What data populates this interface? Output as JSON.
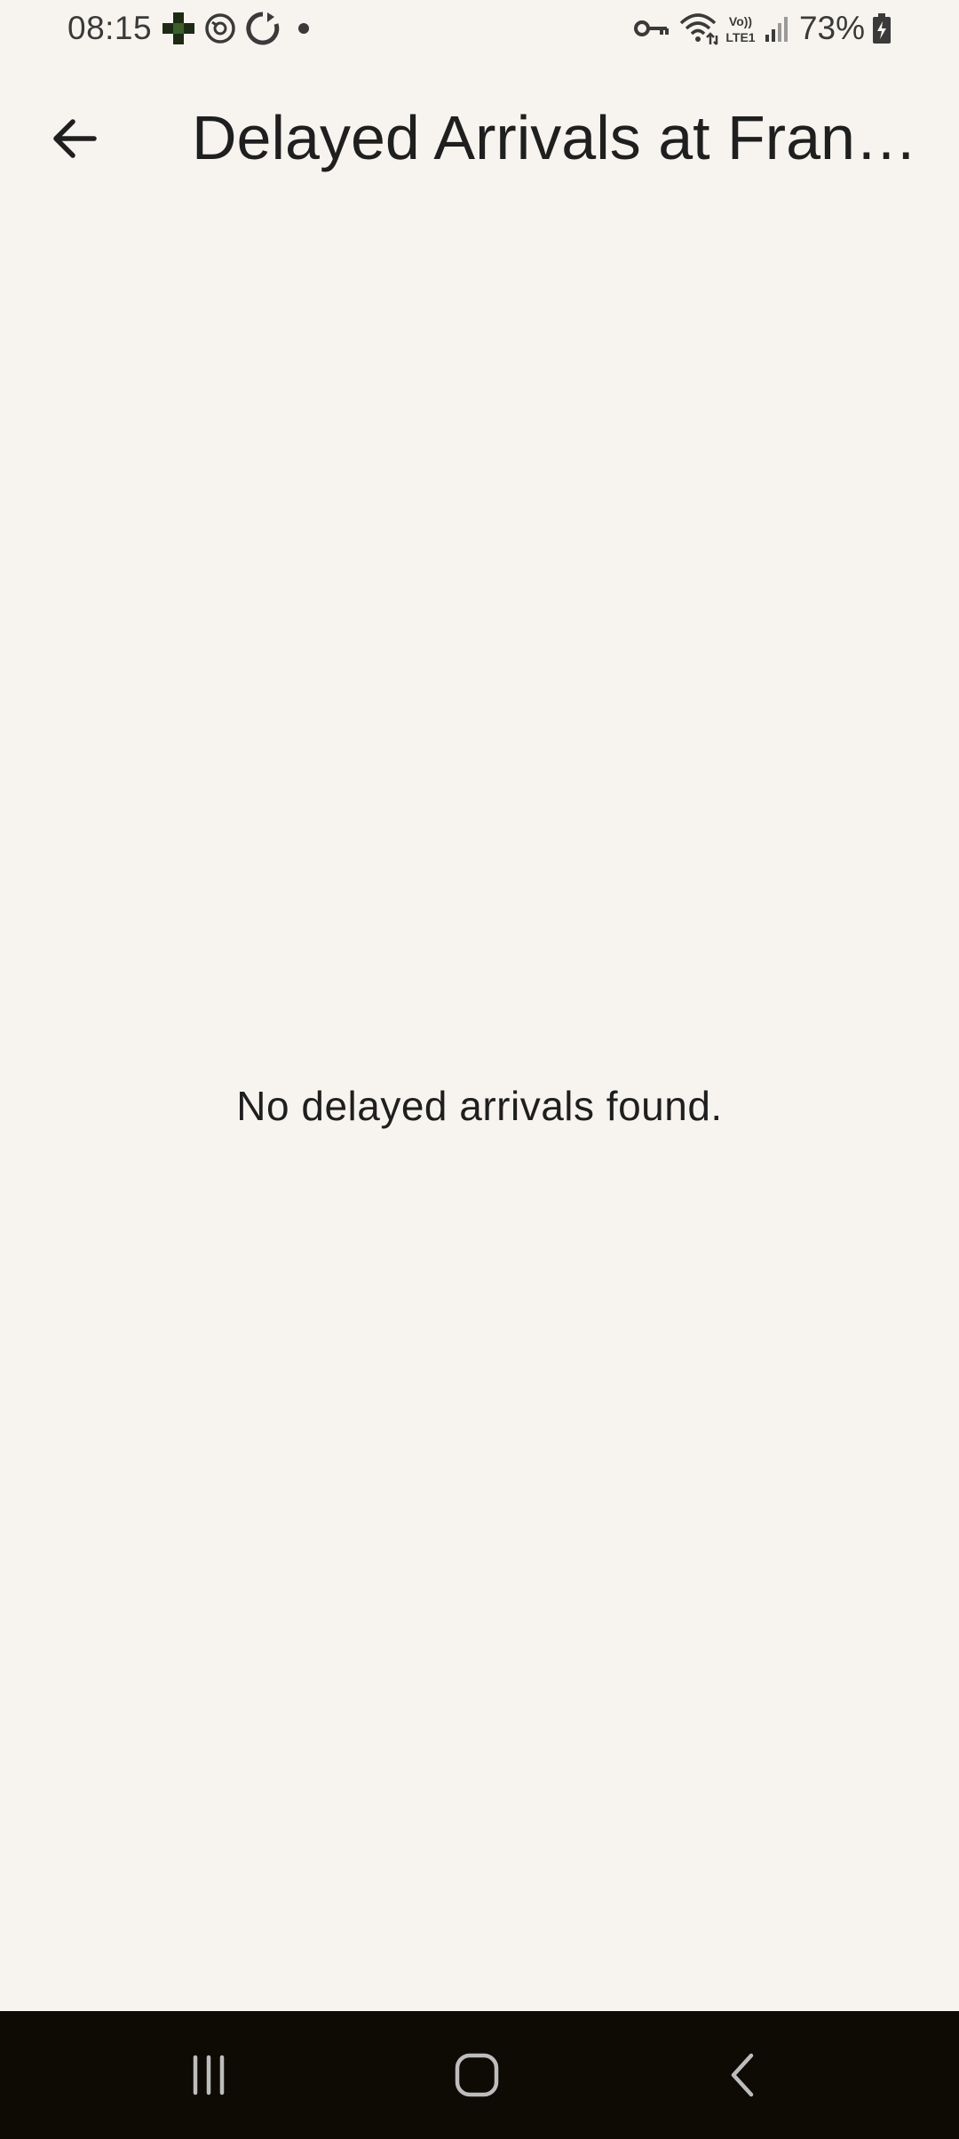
{
  "status_bar": {
    "time": "08:15",
    "battery": "73%",
    "left_icons": [
      "cross-app-icon",
      "sync-circle-icon",
      "refresh-icon",
      "notification-dot-icon"
    ],
    "right_icons": [
      "vpn-key-icon",
      "wifi-icon",
      "volte-icon",
      "signal-icon",
      "battery-icon"
    ]
  },
  "app_bar": {
    "title": "Delayed Arrivals at Fran…",
    "back_icon": "arrow-back-icon"
  },
  "main": {
    "empty_message": "No delayed arrivals found."
  },
  "nav_bar": {
    "buttons": [
      "recents-icon",
      "home-icon",
      "back-chevron-icon"
    ]
  },
  "colors": {
    "background": "#f7f4ef",
    "text": "#1f1f1f",
    "nav_background": "#0e0b05",
    "nav_icon": "#bdbdbd"
  }
}
